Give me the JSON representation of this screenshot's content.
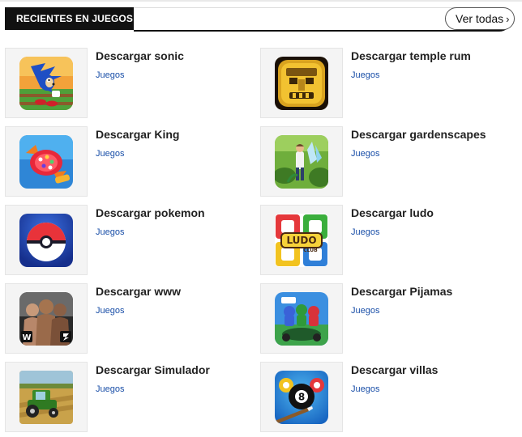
{
  "header": {
    "section_title": "RECIENTES EN JUEGOS",
    "see_all_label": "Ver todas",
    "see_all_icon": "chevron-right-icon"
  },
  "items": [
    {
      "title": "Descargar sonic",
      "category": "Juegos",
      "icon": "sonic-app-icon"
    },
    {
      "title": "Descargar temple rum",
      "category": "Juegos",
      "icon": "temple-run-app-icon"
    },
    {
      "title": "Descargar King",
      "category": "Juegos",
      "icon": "candy-crush-app-icon"
    },
    {
      "title": "Descargar gardenscapes",
      "category": "Juegos",
      "icon": "gardenscapes-app-icon"
    },
    {
      "title": "Descargar pokemon",
      "category": "Juegos",
      "icon": "pokeball-app-icon"
    },
    {
      "title": "Descargar ludo",
      "category": "Juegos",
      "icon": "ludo-club-app-icon"
    },
    {
      "title": "Descargar www",
      "category": "Juegos",
      "icon": "wrestling-app-icon"
    },
    {
      "title": "Descargar Pijamas",
      "category": "Juegos",
      "icon": "pj-masks-app-icon"
    },
    {
      "title": "Descargar Simulador",
      "category": "Juegos",
      "icon": "farming-simulator-app-icon"
    },
    {
      "title": "Descargar villas",
      "category": "Juegos",
      "icon": "eight-ball-pool-app-icon"
    }
  ],
  "ludo_logo_text": "LUDO",
  "ludo_logo_sub": "CLUB",
  "pool_ball_label": "8",
  "colors": {
    "header_bg": "#111111",
    "header_text": "#ffffff",
    "link_blue": "#1a4fa8",
    "thumb_bg": "#f4f4f4"
  }
}
